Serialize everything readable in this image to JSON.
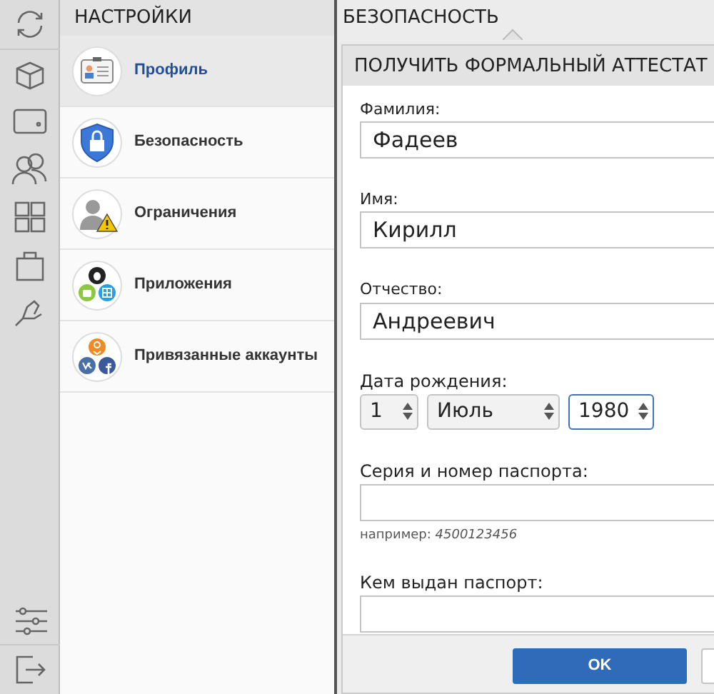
{
  "settings": {
    "title": "НАСТРОЙКИ",
    "items": [
      {
        "label": "Профиль",
        "kind": "profile",
        "selected": true
      },
      {
        "label": "Безопасность",
        "kind": "security",
        "selected": false
      },
      {
        "label": "Ограничения",
        "kind": "restrictions",
        "selected": false
      },
      {
        "label": "Приложения",
        "kind": "apps",
        "selected": false
      },
      {
        "label": "Привязанные аккаунты",
        "kind": "accounts",
        "selected": false
      }
    ]
  },
  "section": {
    "title": "БЕЗОПАСНОСТЬ"
  },
  "dialog": {
    "title": "ПОЛУЧИТЬ ФОРМАЛЬНЫЙ АТТЕСТАТ",
    "fields": [
      {
        "kind": "text",
        "label": "Фамилия:",
        "value": "Фадеев"
      },
      {
        "kind": "text",
        "label": "Имя:",
        "value": "Кирилл"
      },
      {
        "kind": "text",
        "label": "Отчество:",
        "value": "Андреевич"
      },
      {
        "kind": "date",
        "label": "Дата рождения:",
        "parts": [
          {
            "value": "1",
            "focused": false
          },
          {
            "value": "Июль",
            "focused": false
          },
          {
            "value": "1980",
            "focused": true
          }
        ]
      },
      {
        "kind": "text",
        "label": "Серия и номер паспорта:",
        "hint": "например: *4500123456*"
      },
      {
        "kind": "text",
        "label": "Кем выдан паспорт:"
      }
    ],
    "buttons": [
      {
        "kind": "primary",
        "label": "OK"
      },
      {
        "kind": "secondary"
      }
    ]
  }
}
